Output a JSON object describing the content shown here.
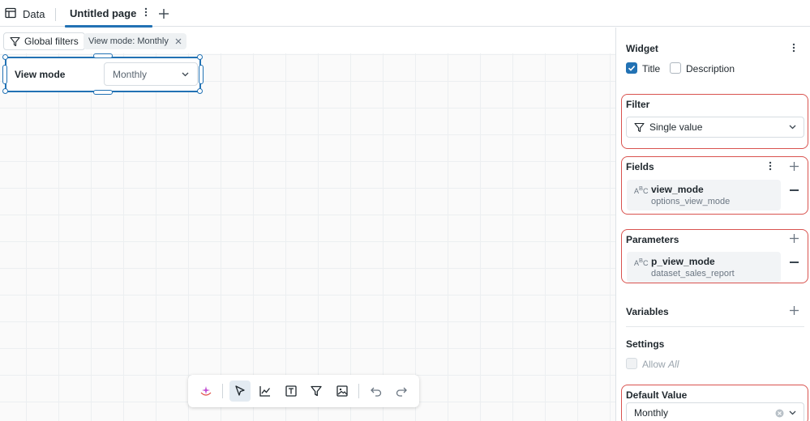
{
  "tabs": {
    "data_label": "Data",
    "page_label": "Untitled page"
  },
  "filterbar": {
    "global_filters": "Global filters",
    "chip_label": "View mode: Monthly"
  },
  "widget": {
    "label": "View mode",
    "value": "Monthly"
  },
  "panel": {
    "widget_title": "Widget",
    "title_option": "Title",
    "description_option": "Description",
    "filter_title": "Filter",
    "filter_type": "Single value",
    "fields_title": "Fields",
    "field_name": "view_mode",
    "field_source": "options_view_mode",
    "parameters_title": "Parameters",
    "param_name": "p_view_mode",
    "param_source": "dataset_sales_report",
    "variables_title": "Variables",
    "settings_title": "Settings",
    "allow_prefix": "Allow",
    "allow_em": "All",
    "default_value_title": "Default Value",
    "default_value": "Monthly"
  },
  "colors": {
    "accent": "#2272b4",
    "highlight": "#d9534f"
  },
  "icons": {
    "data": "table-icon",
    "kebab": "kebab-icon",
    "add": "plus-icon",
    "filter": "filter-icon",
    "close": "close-icon",
    "chevron": "chevron-down-icon",
    "assistant": "assistant-icon",
    "pointer": "pointer-icon",
    "chart": "line-chart-icon",
    "text": "text-box-icon",
    "image": "image-icon",
    "undo": "undo-icon",
    "redo": "redo-icon"
  }
}
